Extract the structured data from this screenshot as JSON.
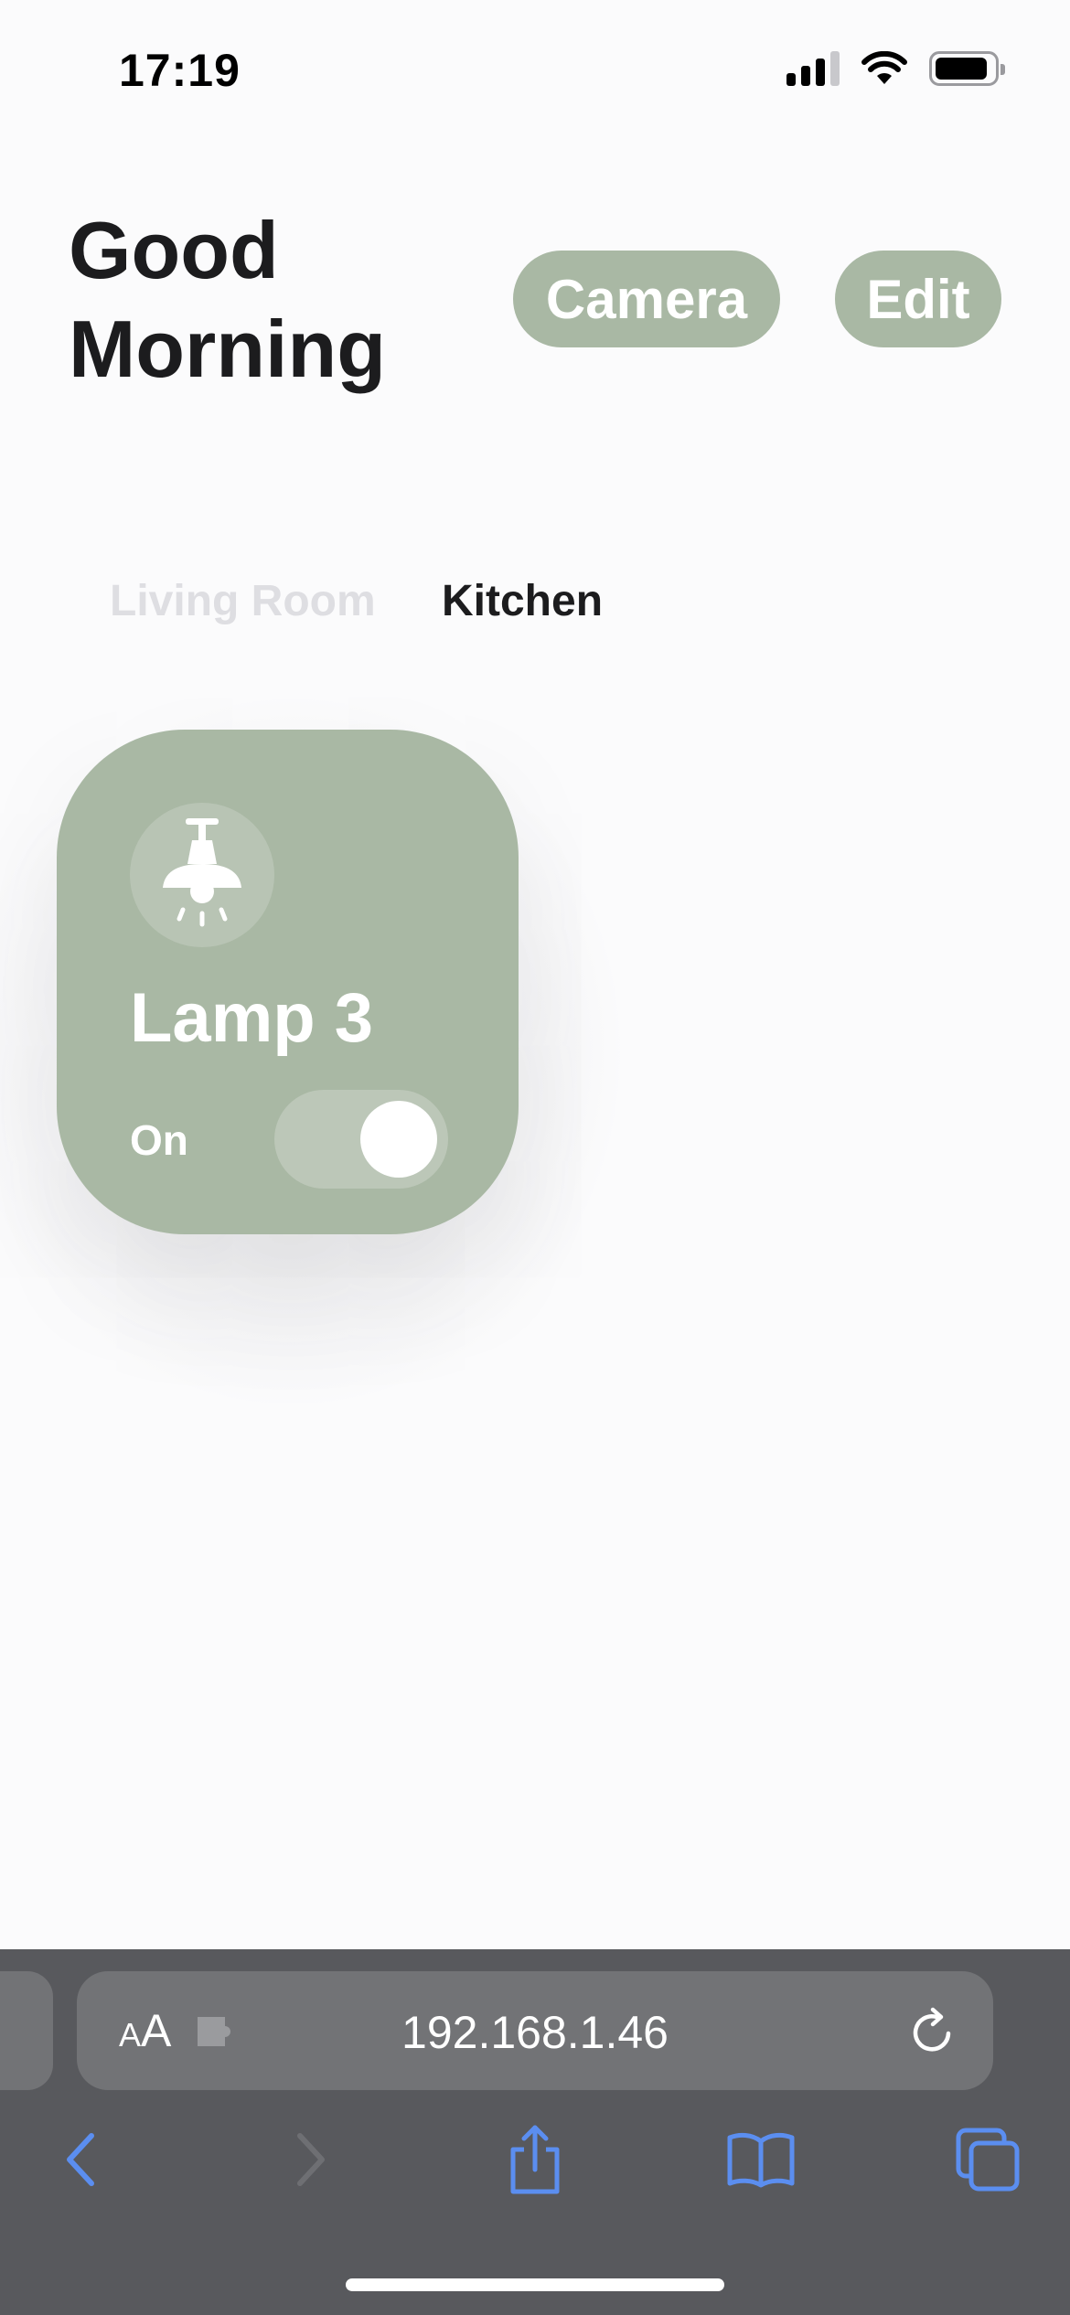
{
  "status_bar": {
    "time": "17:19"
  },
  "header": {
    "greeting": "Good Morning",
    "camera_button": "Camera",
    "edit_button": "Edit"
  },
  "rooms": {
    "tabs": [
      {
        "label": "Living Room",
        "selected": false
      },
      {
        "label": "Kitchen",
        "selected": true
      }
    ]
  },
  "device": {
    "name": "Lamp 3",
    "status": "On",
    "is_on": true,
    "icon": "ceiling-lamp-icon"
  },
  "browser": {
    "aa_small": "A",
    "aa_large": "A",
    "url": "192.168.1.46"
  },
  "colors": {
    "accent": "#a9b8a4",
    "toolbar_bg": "#58595d",
    "toolbar_icon": "#5b8ef0"
  }
}
